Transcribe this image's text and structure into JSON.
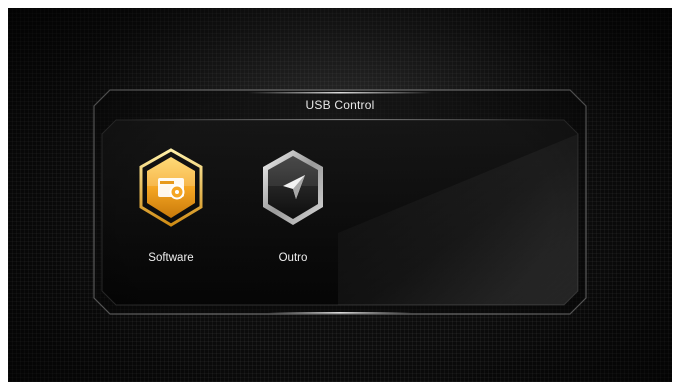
{
  "panel": {
    "title": "USB Control"
  },
  "menu": {
    "items": [
      {
        "label": "Software",
        "icon": "software-disk-icon",
        "selected": true
      },
      {
        "label": "Outro",
        "icon": "arrow-pointer-icon",
        "selected": false
      }
    ]
  },
  "colors": {
    "accent": "#f5a623",
    "background": "#0b0b0b",
    "text": "#ececec"
  }
}
